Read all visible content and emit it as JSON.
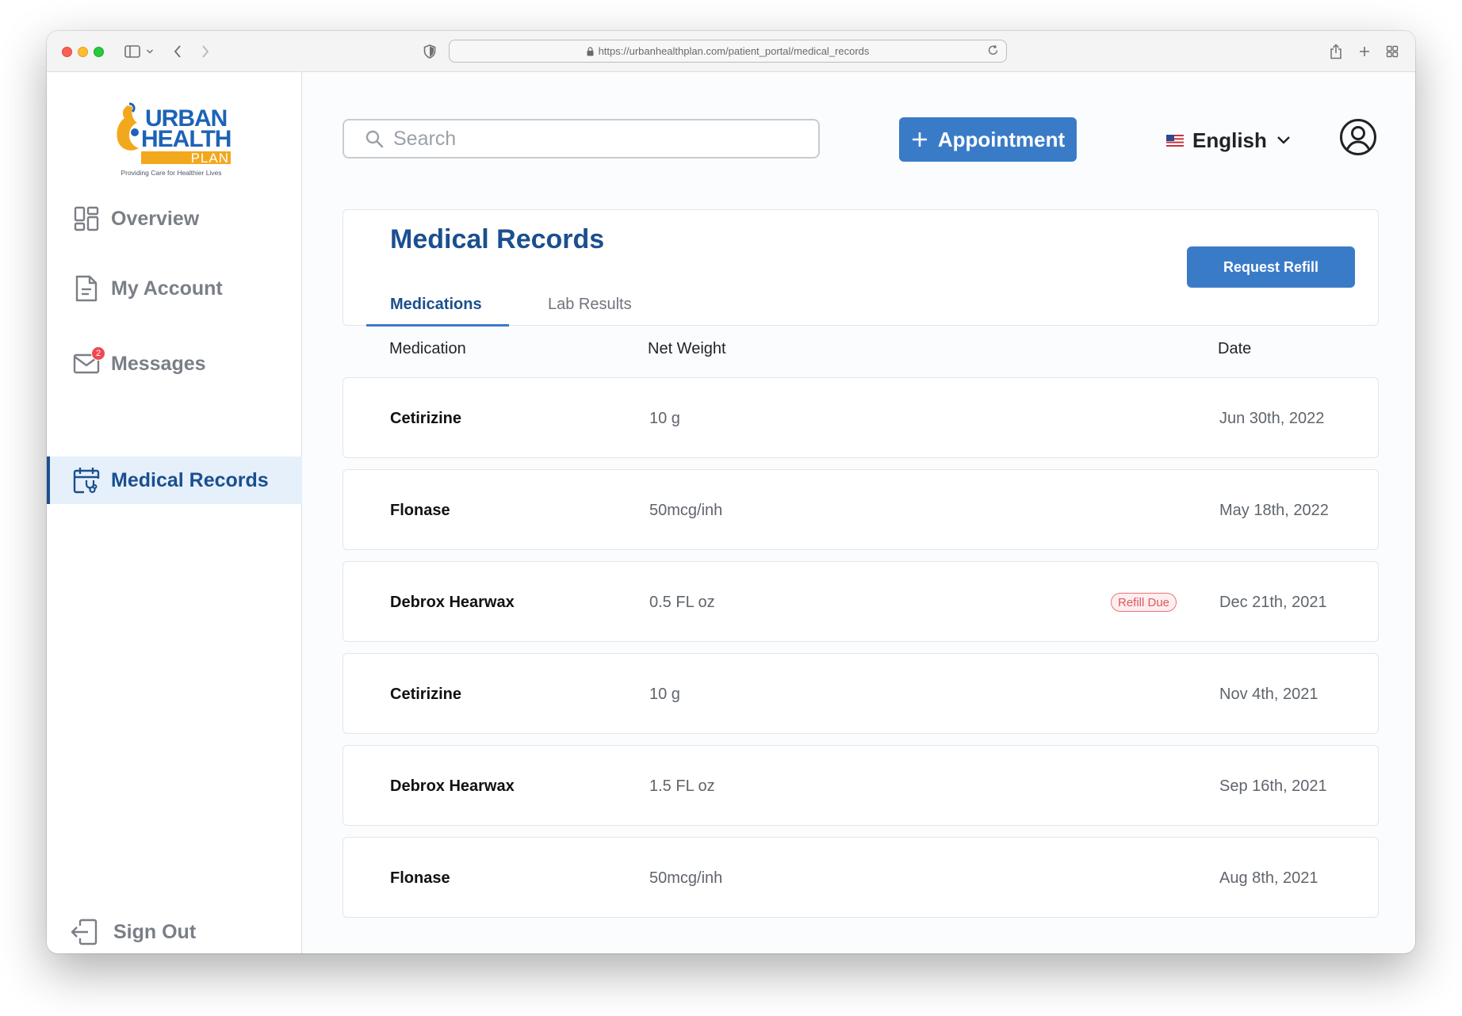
{
  "browser": {
    "url": "https://urbanhealthplan.com/patient_portal/medical_records"
  },
  "logo": {
    "line1": "URBAN",
    "line2": "HEALTH",
    "line3": "PLAN",
    "tagline": "Providing Care for Healthier Lives",
    "colors": {
      "blue": "#1c63b7",
      "orange": "#f2a81d"
    }
  },
  "sidebar": {
    "items": [
      {
        "label": "Overview",
        "icon": "dashboard-icon",
        "active": false
      },
      {
        "label": "My Account",
        "icon": "document-icon",
        "active": false
      },
      {
        "label": "Messages",
        "icon": "mail-icon",
        "active": false,
        "badge": "2"
      },
      {
        "label": "Medical Records",
        "icon": "calendar-stethoscope-icon",
        "active": true
      }
    ],
    "sign_out": "Sign Out"
  },
  "header": {
    "search_placeholder": "Search",
    "appointment_label": "Appointment",
    "language": "English"
  },
  "records": {
    "title": "Medical Records",
    "refill_button": "Request Refill",
    "tabs": [
      {
        "label": "Medications",
        "active": true
      },
      {
        "label": "Lab Results",
        "active": false
      }
    ],
    "columns": {
      "medication": "Medication",
      "net_weight": "Net Weight",
      "date": "Date"
    },
    "rows": [
      {
        "name": "Cetirizine",
        "weight": "10 g",
        "date": "Jun 30th, 2022",
        "tag": ""
      },
      {
        "name": "Flonase",
        "weight": "50mcg/inh",
        "date": "May 18th, 2022",
        "tag": ""
      },
      {
        "name": "Debrox Hearwax",
        "weight": "0.5 FL oz",
        "date": "Dec 21th, 2021",
        "tag": "Refill Due"
      },
      {
        "name": "Cetirizine",
        "weight": "10 g",
        "date": "Nov 4th, 2021",
        "tag": ""
      },
      {
        "name": "Debrox Hearwax",
        "weight": "1.5 FL oz",
        "date": "Sep 16th, 2021",
        "tag": ""
      },
      {
        "name": "Flonase",
        "weight": "50mcg/inh",
        "date": "Aug 8th, 2021",
        "tag": ""
      }
    ]
  },
  "colors": {
    "accent": "#3a7bc8",
    "primary_text": "#1b4f8f",
    "active_bg": "#e5f0fb",
    "badge": "#f0484f",
    "refill_due": "#e0585f"
  }
}
